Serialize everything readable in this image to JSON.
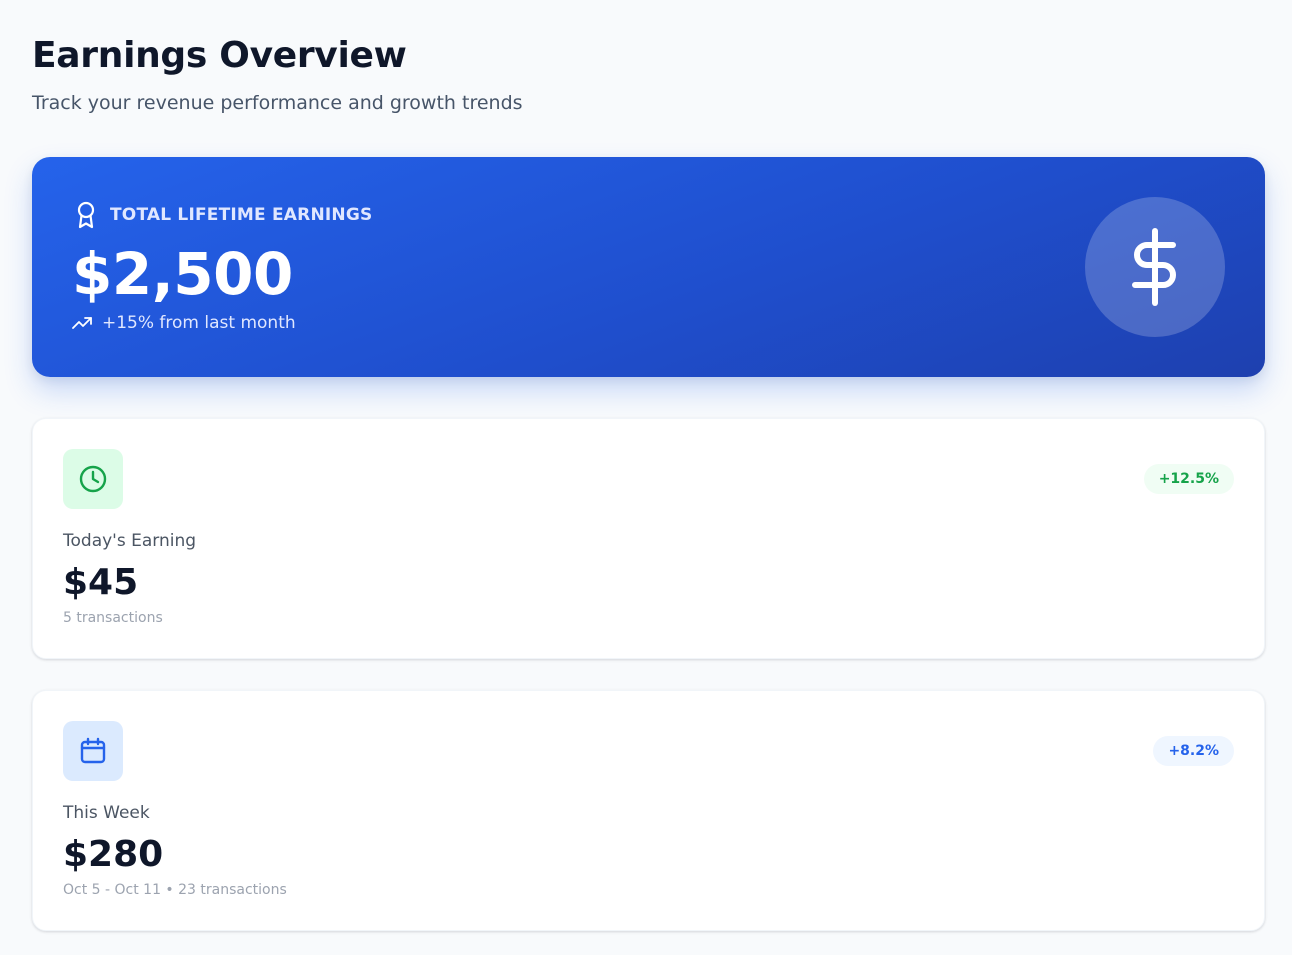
{
  "header": {
    "title": "Earnings Overview",
    "subtitle": "Track your revenue performance and growth trends"
  },
  "hero": {
    "label": "TOTAL LIFETIME EARNINGS",
    "amount": "$2,500",
    "trend": "+15% from last month",
    "label_icon": "award-icon",
    "trend_icon": "trending-up-icon",
    "feature_icon": "dollar-sign-icon"
  },
  "today": {
    "label": "Today's Earning",
    "value": "$45",
    "meta": "5 transactions",
    "badge": "+12.5%",
    "icon": "clock-icon",
    "accent": "#16a34a"
  },
  "week": {
    "label": "This Week",
    "value": "$280",
    "meta": "Oct 5 - Oct 11 • 23 transactions",
    "badge": "+8.2%",
    "icon": "calendar-icon",
    "accent": "#2563eb"
  },
  "colors": {
    "hero_gradient_start": "#2563eb",
    "hero_gradient_end": "#1e40af",
    "page_background": "#f8fafc"
  }
}
